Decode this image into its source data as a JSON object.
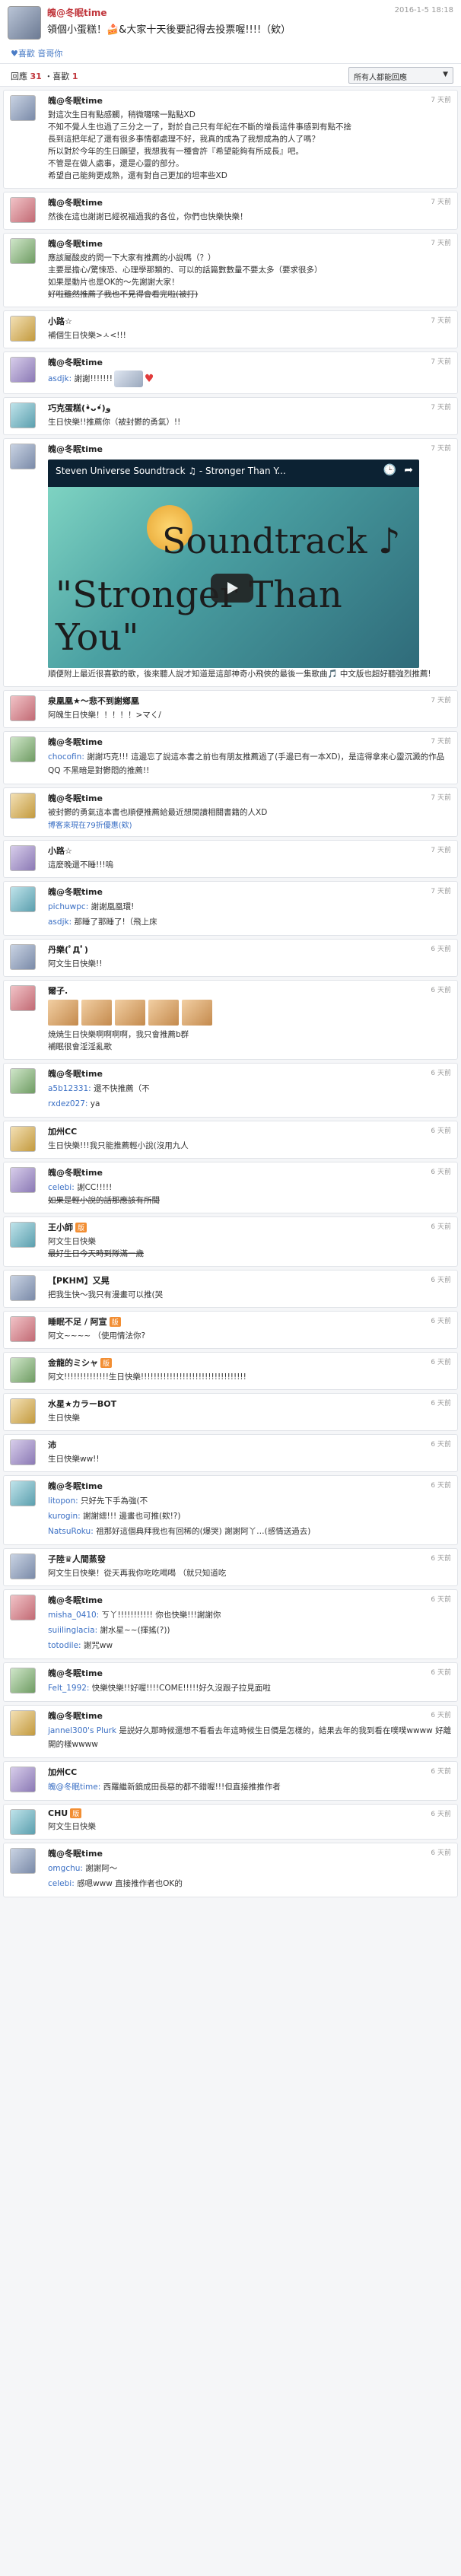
{
  "post": {
    "author": "魄@冬眠time",
    "time": "2016-1-5 18:18",
    "message": "領個小蛋糕！🍰&大家十天後要記得去投票喔!!!!（欸）",
    "likes_label": "♥喜歡",
    "reply_label": "音哥你"
  },
  "bar": {
    "count_prefix": "回應",
    "count_value": "31",
    "count_suffix": "・喜歡",
    "likes_count": "1",
    "filter": "所有人都能回應"
  },
  "replies": [
    {
      "name": "魄@冬眠time",
      "time": "7 天前",
      "text": "對這次生日有點感觸，稍微囉嗦一點點XD\n不知不覺人生也過了三分之一了，對於自己只有年紀在不斷的增長這件事感到有點不捨\n長到這把年紀了還有很多事情都處理不好，我真的成為了我想成為的人了嗎？\n所以對於今年的生日願望，我想我有一種會許『希望能夠有所成長』吧。\n不管是在做人處事，還是心靈的部分。\n希望自己能夠更成熟，還有對自己更加的坦率些XD"
    },
    {
      "name": "魄@冬眠time",
      "time": "7 天前",
      "text": "然後在這也謝謝已經祝福過我的各位，你們也快樂快樂！"
    },
    {
      "name": "魄@冬眠time",
      "time": "7 天前",
      "text": "應該屬酸皮的問一下大家有推薦的小說嗎（？）\n主要是擔心/驚悚恐、心理學那類的、可以的話篇數數量不要太多（要求很多）\n如果是動片也是OK的～先謝謝大家！",
      "strike": "好啦雖然推薦了我也不見得會看完啦(被打)"
    },
    {
      "name": "小路☆",
      "time": "7 天前",
      "text": "補個生日快樂>ㅅ<!!!"
    },
    {
      "name": "魄@冬眠time",
      "time": "7 天前",
      "sub": [
        {
          "who": "asdjk:",
          "say": "謝謝!!!!!!!"
        }
      ]
    },
    {
      "name": "巧克蛋糕(•̀ᴗ•́)و",
      "time": "7 天前",
      "text": "生日快樂!!推薦你（被封鬱的勇氣）!!"
    },
    {
      "name": "魄@冬眠time",
      "time": "7 天前",
      "video_title": "Steven Universe Soundtrack ♫ - Stronger Than Y...",
      "video_word1": "Soundtrack ♪",
      "video_word2": "\"Stronger Than You\"",
      "text": "順便附上最近很喜歡的歌，後來聽人說才知道是這部神奇小飛俠的最後一集歌曲🎵 中文版也超好聽強烈推薦!"
    },
    {
      "name": "泉凰凰★〜悲不到謝鄉凰",
      "time": "7 天前",
      "text": "阿魄生日快樂！！！！！>マく/"
    },
    {
      "name": "魄@冬眠time",
      "time": "7 天前",
      "sub": [
        {
          "who": "chocofin:",
          "say": "謝謝巧克!!! 這邊忘了說這本書之前也有朋友推薦過了(手邊已有一本XD)，是這得拿來心靈沉澱的作品QQ 不黑暗是對鬱悶的推薦!!"
        }
      ]
    },
    {
      "name": "魄@冬眠time",
      "time": "7 天前",
      "text": "被封鬱的勇氣這本書也順便推薦給最近想閱讀相關書籍的人XD",
      "more": "博客來現在79折優惠(欸)"
    },
    {
      "name": "小路☆",
      "time": "7 天前",
      "text": "這麼晚還不睡!!!嗚"
    },
    {
      "name": "魄@冬眠time",
      "time": "7 天前",
      "sub": [
        {
          "who": "pichuwpc:",
          "say": "謝謝凰凰環!"
        },
        {
          "who": "asdjk:",
          "say": "那睡了那睡了!（飛上床"
        }
      ]
    },
    {
      "name": "丹樂(ﾟДﾟ)",
      "time": "6 天前",
      "text": "阿文生日快樂!!"
    },
    {
      "name": "爾子.",
      "time": "6 天前",
      "text": "焼焼生日快樂啊啊啊啊，我只會推薦b群\n補眠很會淫淫亂歌"
    },
    {
      "name": "魄@冬眠time",
      "time": "6 天前",
      "sub": [
        {
          "who": "a5b12331:",
          "say": "還不快推薦（不"
        },
        {
          "who": "rxdez027:",
          "say": "ya"
        }
      ]
    },
    {
      "name": "加州CC",
      "time": "6 天前",
      "text": "生日快樂!!!我只能推薦輕小說(沒用九人"
    },
    {
      "name": "魄@冬眠time",
      "time": "6 天前",
      "sub": [
        {
          "who": "celebi:",
          "say": "謝CC!!!!!"
        }
      ],
      "strike": "如果是輕小說的話那應該有所聞"
    },
    {
      "name": "王小師",
      "badge": "版",
      "time": "6 天前",
      "text": "阿文生日快樂",
      "strike": "最好生日今天時到隊滿一歲"
    },
    {
      "name": "【PKHM】又晃",
      "time": "6 天前",
      "text": "把我生快～我只有漫畫可以推(哭"
    },
    {
      "name": "睡眠不足 / 阿宣",
      "badge": "版",
      "time": "6 天前",
      "text": "阿文~~~~ （使用情法你?"
    },
    {
      "name": "金龍的ミシャ",
      "badge": "版",
      "time": "6 天前",
      "text": "阿文!!!!!!!!!!!!!!生日快樂!!!!!!!!!!!!!!!!!!!!!!!!!!!!!!!!!"
    },
    {
      "name": "水星★カラーBOT",
      "time": "6 天前",
      "text": "生日快樂"
    },
    {
      "name": "沛",
      "time": "6 天前",
      "text": "生日快樂ww!!"
    },
    {
      "name": "魄@冬眠time",
      "time": "6 天前",
      "sub": [
        {
          "who": "litopon:",
          "say": "只好先下手為強(不"
        },
        {
          "who": "kurogin:",
          "say": "謝謝總!!! 邊畫也可推(欸!?)"
        },
        {
          "who": "NatsuRoku:",
          "say": "祖那好這個典拜我也有回稀的(爆哭) 謝謝阿丫…(感情送過去)"
        }
      ]
    },
    {
      "name": "子陸♛人間蒸發",
      "time": "6 天前",
      "text": "阿文生日快樂！從天再我你吃吃喝喝 （就只知道吃"
    },
    {
      "name": "魄@冬眠time",
      "time": "6 天前",
      "sub": [
        {
          "who": "misha_0410:",
          "say": "ㄎ丫!!!!!!!!!!! 你也快樂!!!謝謝你"
        },
        {
          "who": "suiilinglacia:",
          "say": "謝水星~~(揮搖(?))"
        },
        {
          "who": "totodile:",
          "say": "謝咒ww"
        }
      ]
    },
    {
      "name": "魄@冬眠time",
      "time": "6 天前",
      "sub": [
        {
          "who": "Felt_1992:",
          "say": "快樂快樂!!好喔!!!!COME!!!!!好久沒跟子拉見面啦"
        }
      ]
    },
    {
      "name": "魄@冬眠time",
      "time": "6 天前",
      "sub": [
        {
          "who": "jannel300's Plurk",
          "say": "是説好久那時候還想不看看去年這時候生日價是怎樣的，結果去年的我到看在噗噗wwww 好離開的樣wwww"
        }
      ]
    },
    {
      "name": "加州CC",
      "time": "6 天前",
      "sub": [
        {
          "who": "魄@冬眠time:",
          "say": "西羅繼新鏡成田長惡的都不錯喔!!!但直接推推作者"
        }
      ]
    },
    {
      "name": "CHU",
      "badge": "版",
      "time": "6 天前",
      "text": "阿文生日快樂"
    },
    {
      "name": "魄@冬眠time",
      "time": "6 天前",
      "sub": [
        {
          "who": "omgchu:",
          "say": "謝謝阿～"
        },
        {
          "who": "celebi:",
          "say": "感嗯www 直接推作者也OK的"
        }
      ]
    }
  ]
}
